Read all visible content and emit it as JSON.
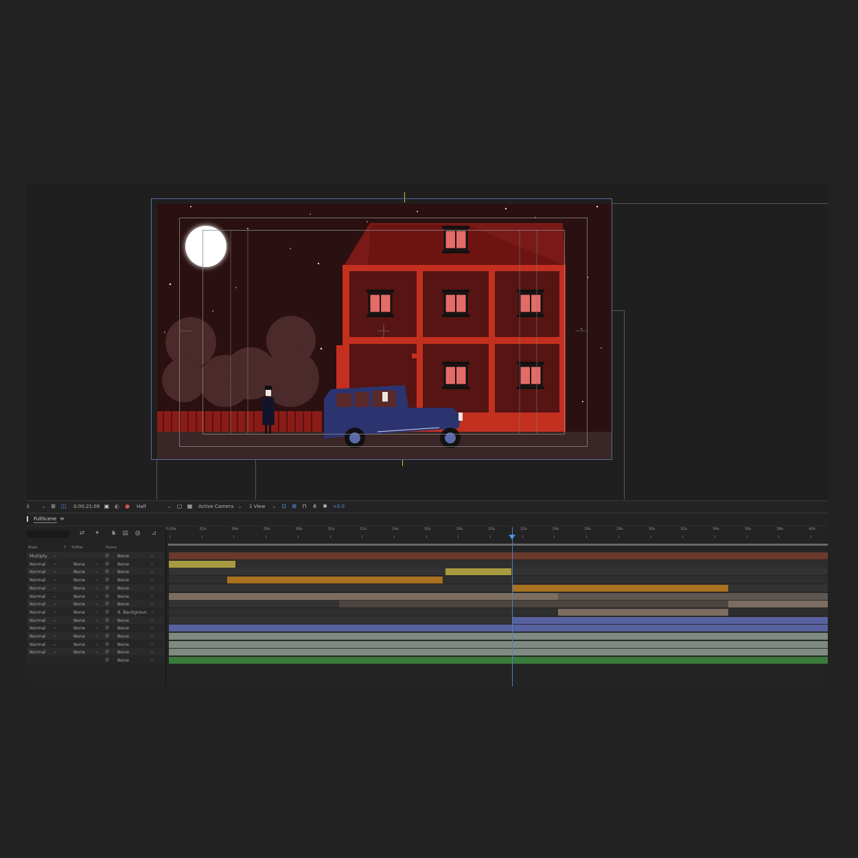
{
  "viewer_toolbar": {
    "left_value": "ŝ",
    "timecode": "0:00:21:09",
    "resolution": "Half",
    "camera": "Active Camera",
    "views": "1 View",
    "exposure": "+0.0"
  },
  "timeline": {
    "tab_label": "FullScene",
    "tab_menu": "≡",
    "columns": {
      "mode": "Mode",
      "t": "T",
      "trkmat": "TrkMat",
      "parent": "Parent"
    },
    "ruler_labels": [
      "0:00s",
      "02s",
      "04s",
      "06s",
      "08s",
      "10s",
      "12s",
      "14s",
      "16s",
      "18s",
      "20s",
      "22s",
      "24s",
      "26s",
      "28s",
      "30s",
      "32s",
      "34s",
      "36s",
      "38s",
      "40s"
    ],
    "layers": [
      {
        "mode": "Multiply",
        "trkmat": "",
        "parent": "None"
      },
      {
        "mode": "Normal",
        "trkmat": "None",
        "parent": "None"
      },
      {
        "mode": "Normal",
        "trkmat": "None",
        "parent": "None"
      },
      {
        "mode": "Normal",
        "trkmat": "None",
        "parent": "None"
      },
      {
        "mode": "Normal",
        "trkmat": "None",
        "parent": "None"
      },
      {
        "mode": "Normal",
        "trkmat": "None",
        "parent": "None"
      },
      {
        "mode": "Normal",
        "trkmat": "None",
        "parent": "None"
      },
      {
        "mode": "Normal",
        "trkmat": "None",
        "parent": "9. Backgroun"
      },
      {
        "mode": "Normal",
        "trkmat": "None",
        "parent": "None"
      },
      {
        "mode": "Normal",
        "trkmat": "None",
        "parent": "None"
      },
      {
        "mode": "Normal",
        "trkmat": "None",
        "parent": "None"
      },
      {
        "mode": "Normal",
        "trkmat": "None",
        "parent": "None"
      },
      {
        "mode": "Normal",
        "trkmat": "None",
        "parent": "None"
      },
      {
        "mode": "",
        "trkmat": "",
        "parent": "None"
      }
    ]
  },
  "colors": {
    "accent": "#4f8fe8",
    "sky": "#2a1010",
    "house": "#c0301f",
    "car": "#2c3470",
    "bar_olive": "#a89a3e",
    "bar_orange": "#a8711f",
    "bar_tan": "#7b6e60",
    "bar_blue": "#5862a0",
    "bar_gray": "#7f8a80",
    "bar_green": "#3a7a3a",
    "bar_brown": "#6a3a2a"
  }
}
